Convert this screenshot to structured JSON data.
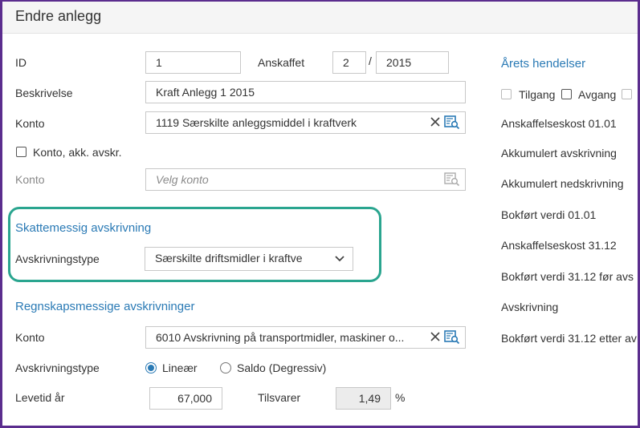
{
  "dialog": {
    "title": "Endre anlegg"
  },
  "form": {
    "id_label": "ID",
    "id_value": "1",
    "anskaffet_label": "Anskaffet",
    "anskaffet_month": "2",
    "anskaffet_sep": "/",
    "anskaffet_year": "2015",
    "beskrivelse_label": "Beskrivelse",
    "beskrivelse_value": "Kraft Anlegg 1 2015",
    "konto_label": "Konto",
    "konto_value": "1119 Særskilte anleggsmiddel i kraftverk",
    "konto_akk_label": "Konto, akk. avskr.",
    "konto2_label": "Konto",
    "konto2_placeholder": "Velg konto"
  },
  "skatt": {
    "title": "Skattemessig avskrivning",
    "type_label": "Avskrivningstype",
    "type_value": "Særskilte driftsmidler i kraftve"
  },
  "regnskap": {
    "title": "Regnskapsmessige avskrivninger",
    "konto_label": "Konto",
    "konto_value": "6010 Avskrivning på transportmidler, maskiner o...",
    "type_label": "Avskrivningstype",
    "option_linear": "Lineær",
    "option_saldo": "Saldo (Degressiv)",
    "levetid_label": "Levetid år",
    "levetid_value": "67,000",
    "tilsvarer_label": "Tilsvarer",
    "tilsvarer_value": "1,49",
    "percent": "%"
  },
  "events": {
    "title": "Årets hendelser",
    "tilgang": "Tilgang",
    "avgang": "Avgang",
    "rows": [
      "Anskaffelseskost 01.01",
      "Akkumulert avskrivning",
      "Akkumulert nedskrivning",
      "Bokført verdi 01.01",
      "Anskaffelseskost 31.12",
      "Bokført verdi 31.12 før avs",
      "Avskrivning",
      "Bokført verdi 31.12 etter av"
    ]
  },
  "colors": {
    "accent": "#2a7ab5",
    "frame": "#5b2d8e",
    "highlight": "#2aa58f"
  }
}
